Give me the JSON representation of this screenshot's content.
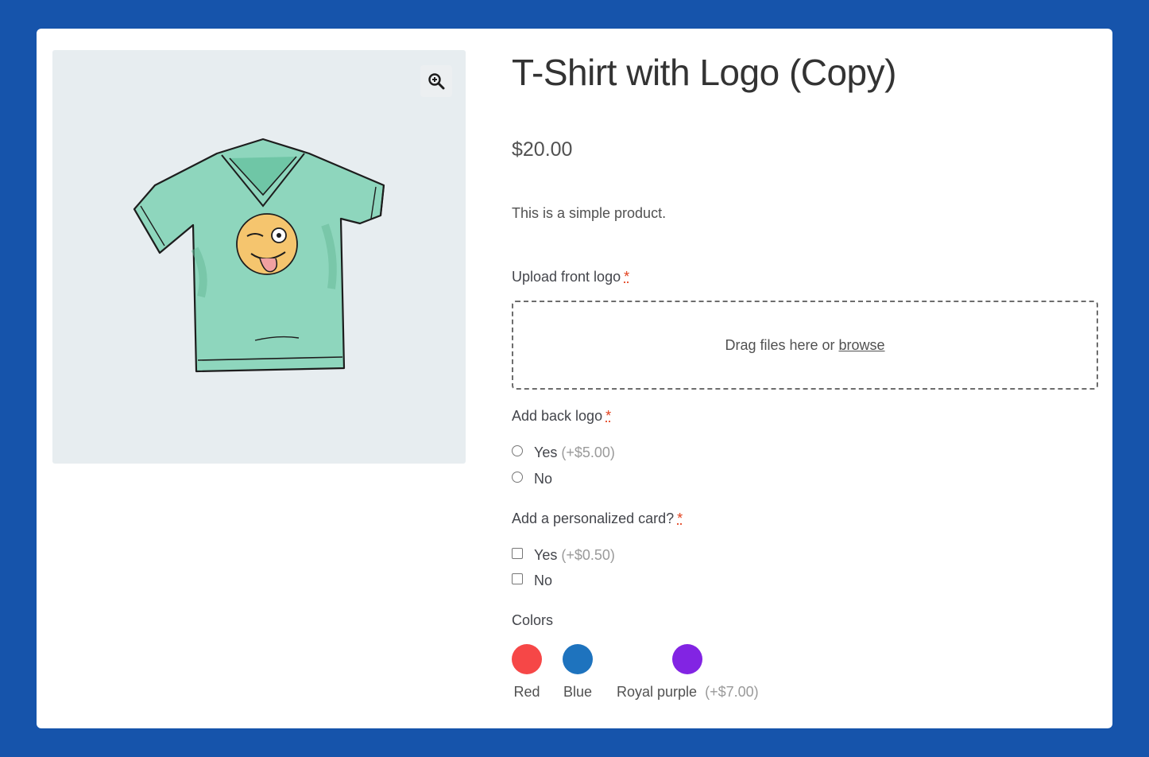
{
  "product": {
    "title": "T-Shirt with Logo (Copy)",
    "price": "$20.00",
    "description": "This is a simple product."
  },
  "gallery": {
    "zoom_icon": "zoom-in-icon"
  },
  "fields": {
    "front_logo": {
      "label": "Upload front logo",
      "required": "*",
      "drop_text": "Drag files here or",
      "browse_label": "browse"
    },
    "back_logo": {
      "label": "Add back logo",
      "required": "*",
      "options": [
        {
          "label": "Yes",
          "addon": "(+$5.00)"
        },
        {
          "label": "No",
          "addon": ""
        }
      ]
    },
    "card": {
      "label": "Add a personalized card?",
      "required": "*",
      "options": [
        {
          "label": "Yes",
          "addon": "(+$0.50)"
        },
        {
          "label": "No",
          "addon": ""
        }
      ]
    },
    "colors": {
      "label": "Colors",
      "swatches": [
        {
          "label": "Red",
          "addon": "",
          "color": "#f64747"
        },
        {
          "label": "Blue",
          "addon": "",
          "color": "#1e73be"
        },
        {
          "label": "Royal purple",
          "addon": "(+$7.00)",
          "color": "#8224e3"
        }
      ]
    }
  },
  "colors": {
    "page_background": "#1654ab",
    "card_background": "#ffffff",
    "gallery_background": "#e7edf0",
    "required_marker": "#e2401c",
    "shirt_fill": "#8ed6bd"
  }
}
